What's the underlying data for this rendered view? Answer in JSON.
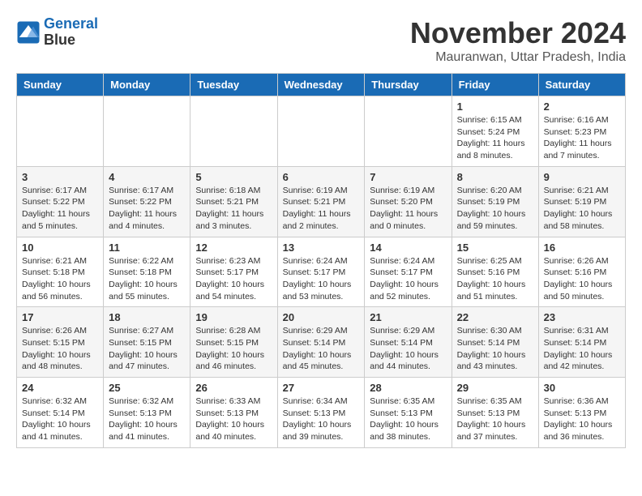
{
  "header": {
    "logo_line1": "General",
    "logo_line2": "Blue",
    "month": "November 2024",
    "location": "Mauranwan, Uttar Pradesh, India"
  },
  "weekdays": [
    "Sunday",
    "Monday",
    "Tuesday",
    "Wednesday",
    "Thursday",
    "Friday",
    "Saturday"
  ],
  "weeks": [
    [
      {
        "day": "",
        "info": ""
      },
      {
        "day": "",
        "info": ""
      },
      {
        "day": "",
        "info": ""
      },
      {
        "day": "",
        "info": ""
      },
      {
        "day": "",
        "info": ""
      },
      {
        "day": "1",
        "info": "Sunrise: 6:15 AM\nSunset: 5:24 PM\nDaylight: 11 hours and 8 minutes."
      },
      {
        "day": "2",
        "info": "Sunrise: 6:16 AM\nSunset: 5:23 PM\nDaylight: 11 hours and 7 minutes."
      }
    ],
    [
      {
        "day": "3",
        "info": "Sunrise: 6:17 AM\nSunset: 5:22 PM\nDaylight: 11 hours and 5 minutes."
      },
      {
        "day": "4",
        "info": "Sunrise: 6:17 AM\nSunset: 5:22 PM\nDaylight: 11 hours and 4 minutes."
      },
      {
        "day": "5",
        "info": "Sunrise: 6:18 AM\nSunset: 5:21 PM\nDaylight: 11 hours and 3 minutes."
      },
      {
        "day": "6",
        "info": "Sunrise: 6:19 AM\nSunset: 5:21 PM\nDaylight: 11 hours and 2 minutes."
      },
      {
        "day": "7",
        "info": "Sunrise: 6:19 AM\nSunset: 5:20 PM\nDaylight: 11 hours and 0 minutes."
      },
      {
        "day": "8",
        "info": "Sunrise: 6:20 AM\nSunset: 5:19 PM\nDaylight: 10 hours and 59 minutes."
      },
      {
        "day": "9",
        "info": "Sunrise: 6:21 AM\nSunset: 5:19 PM\nDaylight: 10 hours and 58 minutes."
      }
    ],
    [
      {
        "day": "10",
        "info": "Sunrise: 6:21 AM\nSunset: 5:18 PM\nDaylight: 10 hours and 56 minutes."
      },
      {
        "day": "11",
        "info": "Sunrise: 6:22 AM\nSunset: 5:18 PM\nDaylight: 10 hours and 55 minutes."
      },
      {
        "day": "12",
        "info": "Sunrise: 6:23 AM\nSunset: 5:17 PM\nDaylight: 10 hours and 54 minutes."
      },
      {
        "day": "13",
        "info": "Sunrise: 6:24 AM\nSunset: 5:17 PM\nDaylight: 10 hours and 53 minutes."
      },
      {
        "day": "14",
        "info": "Sunrise: 6:24 AM\nSunset: 5:17 PM\nDaylight: 10 hours and 52 minutes."
      },
      {
        "day": "15",
        "info": "Sunrise: 6:25 AM\nSunset: 5:16 PM\nDaylight: 10 hours and 51 minutes."
      },
      {
        "day": "16",
        "info": "Sunrise: 6:26 AM\nSunset: 5:16 PM\nDaylight: 10 hours and 50 minutes."
      }
    ],
    [
      {
        "day": "17",
        "info": "Sunrise: 6:26 AM\nSunset: 5:15 PM\nDaylight: 10 hours and 48 minutes."
      },
      {
        "day": "18",
        "info": "Sunrise: 6:27 AM\nSunset: 5:15 PM\nDaylight: 10 hours and 47 minutes."
      },
      {
        "day": "19",
        "info": "Sunrise: 6:28 AM\nSunset: 5:15 PM\nDaylight: 10 hours and 46 minutes."
      },
      {
        "day": "20",
        "info": "Sunrise: 6:29 AM\nSunset: 5:14 PM\nDaylight: 10 hours and 45 minutes."
      },
      {
        "day": "21",
        "info": "Sunrise: 6:29 AM\nSunset: 5:14 PM\nDaylight: 10 hours and 44 minutes."
      },
      {
        "day": "22",
        "info": "Sunrise: 6:30 AM\nSunset: 5:14 PM\nDaylight: 10 hours and 43 minutes."
      },
      {
        "day": "23",
        "info": "Sunrise: 6:31 AM\nSunset: 5:14 PM\nDaylight: 10 hours and 42 minutes."
      }
    ],
    [
      {
        "day": "24",
        "info": "Sunrise: 6:32 AM\nSunset: 5:14 PM\nDaylight: 10 hours and 41 minutes."
      },
      {
        "day": "25",
        "info": "Sunrise: 6:32 AM\nSunset: 5:13 PM\nDaylight: 10 hours and 41 minutes."
      },
      {
        "day": "26",
        "info": "Sunrise: 6:33 AM\nSunset: 5:13 PM\nDaylight: 10 hours and 40 minutes."
      },
      {
        "day": "27",
        "info": "Sunrise: 6:34 AM\nSunset: 5:13 PM\nDaylight: 10 hours and 39 minutes."
      },
      {
        "day": "28",
        "info": "Sunrise: 6:35 AM\nSunset: 5:13 PM\nDaylight: 10 hours and 38 minutes."
      },
      {
        "day": "29",
        "info": "Sunrise: 6:35 AM\nSunset: 5:13 PM\nDaylight: 10 hours and 37 minutes."
      },
      {
        "day": "30",
        "info": "Sunrise: 6:36 AM\nSunset: 5:13 PM\nDaylight: 10 hours and 36 minutes."
      }
    ]
  ]
}
